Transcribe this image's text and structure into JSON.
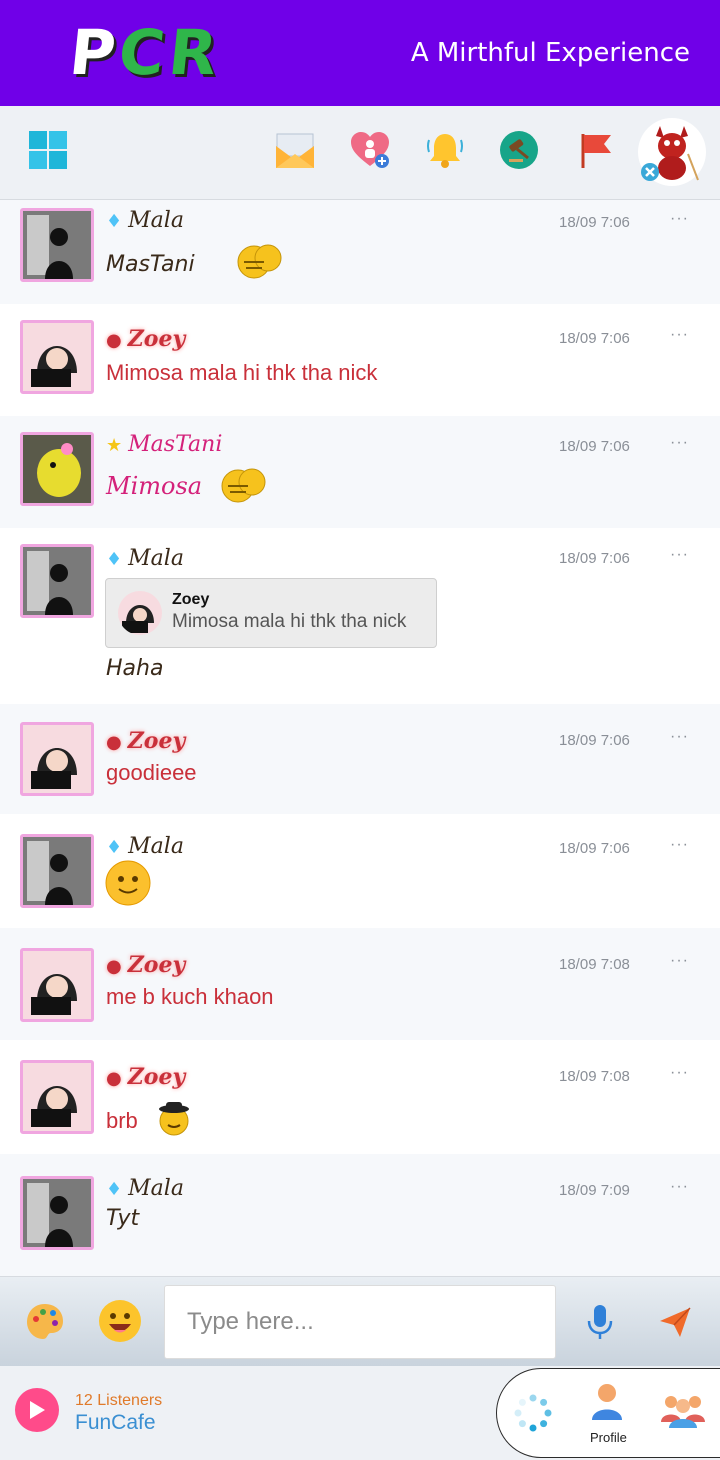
{
  "header": {
    "logo": [
      "P",
      "C",
      "R"
    ],
    "tagline": "A Mirthful Experience"
  },
  "toolbar": {
    "icons": [
      "windows-menu-icon",
      "mail-icon",
      "friend-requests-icon",
      "bell-icon",
      "gavel-icon",
      "flag-icon",
      "user-avatar"
    ]
  },
  "messages": [
    {
      "user": "Mala",
      "badge": "diamond",
      "time": "18/09 7:06",
      "text": "MasTani",
      "emoji": "hug"
    },
    {
      "user": "Zoey",
      "badge": "bear",
      "time": "18/09 7:06",
      "text": "Mimosa mala hi thk tha nick"
    },
    {
      "user": "MasTani",
      "badge": "star",
      "time": "18/09 7:06",
      "text": "Mimosa",
      "emoji": "hug"
    },
    {
      "user": "Mala",
      "badge": "diamond",
      "time": "18/09 7:06",
      "reply_user": "Zoey",
      "reply_text": "Mimosa mala hi thk tha nick",
      "text": "Haha"
    },
    {
      "user": "Zoey",
      "badge": "bear",
      "time": "18/09 7:06",
      "text": "goodieee"
    },
    {
      "user": "Mala",
      "badge": "diamond",
      "time": "18/09 7:06",
      "text": "",
      "emoji": "smile"
    },
    {
      "user": "Zoey",
      "badge": "bear",
      "time": "18/09 7:08",
      "text": "me b kuch khaon"
    },
    {
      "user": "Zoey",
      "badge": "bear",
      "time": "18/09 7:08",
      "text": "brb",
      "emoji": "spy"
    },
    {
      "user": "Mala",
      "badge": "diamond",
      "time": "18/09 7:09",
      "text": "Tyt"
    }
  ],
  "composer": {
    "placeholder": "Type here..."
  },
  "radio": {
    "listeners": "12 Listeners",
    "station": "FunCafe"
  },
  "nav": {
    "profile_label": "Profile"
  },
  "colors": {
    "header": "#7000e8",
    "zoey": "#c9303a",
    "mala": "#3a2a1a",
    "mastani": "#d4217a"
  }
}
